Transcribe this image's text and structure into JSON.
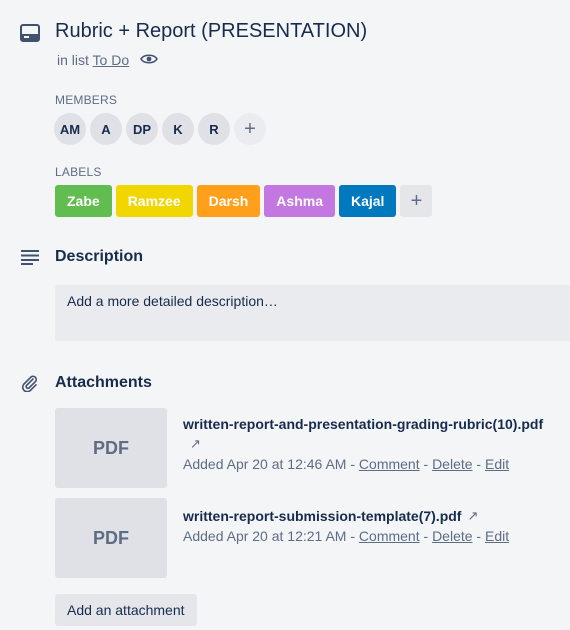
{
  "card": {
    "title": "Rubric + Report (PRESENTATION)",
    "in_list_prefix": "in list",
    "list_name": "To Do"
  },
  "icons": {
    "card": "card-icon",
    "watch": "eye-icon",
    "description": "description-lines-icon",
    "attachment": "paperclip-icon",
    "external": "external-link-icon",
    "add": "plus-icon"
  },
  "members": {
    "label": "MEMBERS",
    "items": [
      "AM",
      "A",
      "DP",
      "K",
      "R"
    ],
    "add_symbol": "+"
  },
  "labels": {
    "label": "LABELS",
    "items": [
      {
        "text": "Zabe",
        "color": "#61bd4f"
      },
      {
        "text": "Ramzee",
        "color": "#f2d600"
      },
      {
        "text": "Darsh",
        "color": "#ff9f1a"
      },
      {
        "text": "Ashma",
        "color": "#c377e0"
      },
      {
        "text": "Kajal",
        "color": "#0079bf"
      }
    ],
    "add_symbol": "+"
  },
  "description": {
    "title": "Description",
    "placeholder": "Add a more detailed description…"
  },
  "attachments": {
    "title": "Attachments",
    "items": [
      {
        "thumb": "PDF",
        "name": "written-report-and-presentation-grading-rubric(10).pdf",
        "ext": "↗",
        "added": "Added Apr 20 at 12:46 AM",
        "sep1": " - ",
        "comment": "Comment",
        "sep2": " - ",
        "delete": "Delete",
        "sep3": " - ",
        "edit": "Edit"
      },
      {
        "thumb": "PDF",
        "name": "written-report-submission-template(7).pdf",
        "ext": "↗",
        "added": "Added Apr 20 at 12:21 AM",
        "sep1": " - ",
        "comment": "Comment",
        "sep2": " - ",
        "delete": "Delete",
        "sep3": " - ",
        "edit": "Edit"
      }
    ],
    "add_button": "Add an attachment"
  }
}
